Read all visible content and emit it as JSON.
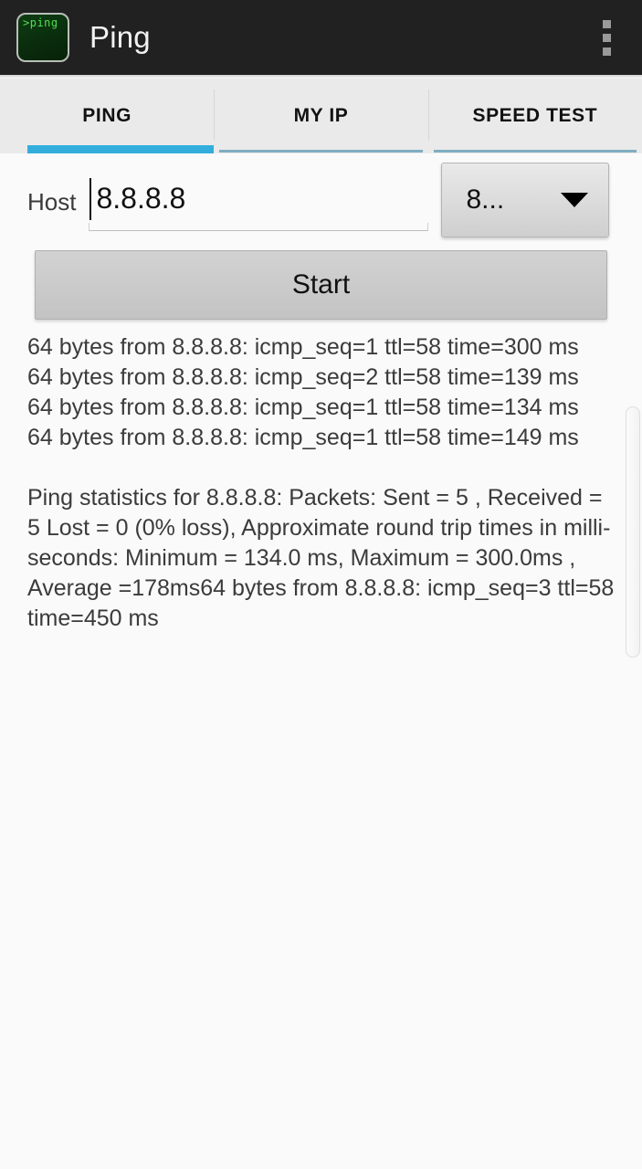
{
  "actionbar": {
    "app_icon_text": ">ping",
    "title": "Ping",
    "overflow_icon": "more-vert-icon"
  },
  "tabs": [
    {
      "label": "PING",
      "active": true
    },
    {
      "label": "MY IP",
      "active": false
    },
    {
      "label": "SPEED TEST",
      "active": false
    }
  ],
  "host_row": {
    "label": "Host",
    "input_value": "8.8.8.8",
    "input_placeholder": "Host",
    "dropdown_value": "8...",
    "dropdown_icon": "caret-down-icon"
  },
  "actions": {
    "start_label": "Start"
  },
  "output": {
    "lines": [
      "64 bytes from 8.8.8.8: icmp_seq=1 ttl=58 time=300 ms",
      "64 bytes from 8.8.8.8: icmp_seq=2 ttl=58 time=139 ms",
      "64 bytes from 8.8.8.8: icmp_seq=1 ttl=58 time=134 ms",
      "64 bytes from 8.8.8.8: icmp_seq=1 ttl=58 time=149 ms"
    ],
    "statistics": "Ping statistics for 8.8.8.8: Packets: Sent = 5 , Received = 5 Lost = 0 (0% loss),  Approximate round trip times in milli-seconds:    Minimum = 134.0 ms, Maximum = 300.0ms , Average =178ms64 bytes from 8.8.8.8: icmp_seq=3 ttl=58 time=450 ms"
  },
  "colors": {
    "actionbar_bg": "#212121",
    "tab_active_indicator": "#33aedc",
    "tab_inactive_indicator": "#7fadc0",
    "page_bg": "#fafafa",
    "icon_green": "#4ee04e"
  }
}
